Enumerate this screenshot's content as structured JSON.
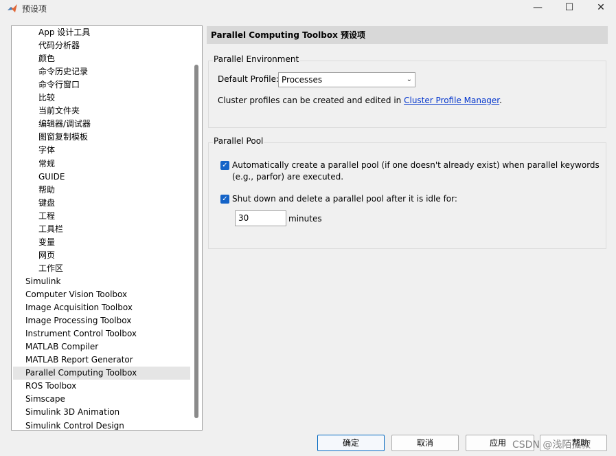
{
  "window": {
    "title": "预设项"
  },
  "tree": {
    "children": [
      "App 设计工具",
      "代码分析器",
      "颜色",
      "命令历史记录",
      "命令行窗口",
      "比较",
      "当前文件夹",
      "编辑器/调试器",
      "图窗复制模板",
      "字体",
      "常规",
      "GUIDE",
      "帮助",
      "键盘",
      "工程",
      "工具栏",
      "变量",
      "网页",
      "工作区"
    ],
    "top": [
      "Simulink",
      "Computer Vision Toolbox",
      "Image Acquisition Toolbox",
      "Image Processing Toolbox",
      "Instrument Control Toolbox",
      "MATLAB Compiler",
      "MATLAB Report Generator",
      "Parallel Computing Toolbox",
      "ROS Toolbox",
      "Simscape",
      "Simulink 3D Animation",
      "Simulink Control Design"
    ],
    "selected": "Parallel Computing Toolbox"
  },
  "panel": {
    "header": "Parallel Computing Toolbox 预设项",
    "env": {
      "title": "Parallel Environment",
      "profile_label": "Default Profile:",
      "profile_value": "Processes",
      "cluster_text": "Cluster profiles can be created and edited in",
      "cluster_link": "Cluster Profile Manager",
      "cluster_end": "."
    },
    "pool": {
      "title": "Parallel Pool",
      "auto_line1": "Automatically create a parallel pool (if one doesn't already exist) when parallel keywords",
      "auto_line2": "(e.g., parfor) are executed.",
      "auto_checked": true,
      "shutdown_label": "Shut down and delete a parallel pool after it is idle for:",
      "shutdown_checked": true,
      "idle_value": "30",
      "idle_unit": "minutes"
    }
  },
  "buttons": {
    "ok": "确定",
    "cancel": "取消",
    "apply": "应用",
    "help": "帮助"
  },
  "watermark": "CSDN @浅陌孤寂",
  "colors": {
    "accent": "#1463c7",
    "link": "#0033cc",
    "header_bg": "#d8d8d8"
  }
}
